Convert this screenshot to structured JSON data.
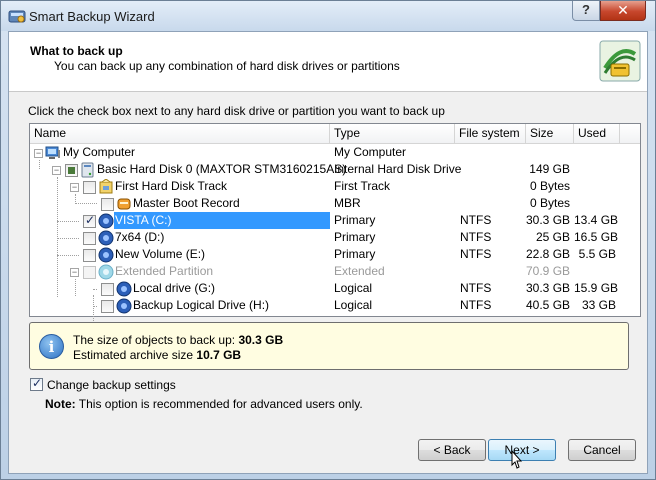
{
  "window": {
    "title": "Smart Backup Wizard",
    "help_label": "?",
    "close_label": "✕"
  },
  "header": {
    "title": "What to back up",
    "subtitle": "You can back up any combination of hard disk drives or partitions"
  },
  "instruction": "Click the check box next to any hard disk drive or partition you want to back up",
  "columns": {
    "name": "Name",
    "type": "Type",
    "filesystem": "File system",
    "size": "Size",
    "used": "Used"
  },
  "rows": [
    {
      "name": "My Computer",
      "type": "My Computer",
      "fs": "",
      "size": "",
      "used": "",
      "icon": "computer-icon",
      "checkbox": "none"
    },
    {
      "name": "Basic Hard Disk 0 (MAXTOR STM3160215AS)",
      "type": "Internal Hard Disk Drive",
      "fs": "",
      "size": "149 GB",
      "used": "",
      "icon": "hard-disk-icon",
      "checkbox": "partial"
    },
    {
      "name": "First Hard Disk Track",
      "type": "First Track",
      "fs": "",
      "size": "0 Bytes",
      "used": "",
      "icon": "disk-track-icon",
      "checkbox": "unchecked"
    },
    {
      "name": "Master Boot Record",
      "type": "MBR",
      "fs": "",
      "size": "0 Bytes",
      "used": "",
      "icon": "mbr-icon",
      "checkbox": "unchecked"
    },
    {
      "name": "VISTA (C:)",
      "type": "Primary",
      "fs": "NTFS",
      "size": "30.3 GB",
      "used": "13.4 GB",
      "icon": "partition-icon",
      "checkbox": "checked",
      "selected": true
    },
    {
      "name": "7x64 (D:)",
      "type": "Primary",
      "fs": "NTFS",
      "size": "25 GB",
      "used": "16.5 GB",
      "icon": "partition-icon",
      "checkbox": "unchecked"
    },
    {
      "name": "New Volume (E:)",
      "type": "Primary",
      "fs": "NTFS",
      "size": "22.8 GB",
      "used": "5.5 GB",
      "icon": "partition-icon",
      "checkbox": "unchecked"
    },
    {
      "name": "Extended Partition",
      "type": "Extended",
      "fs": "",
      "size": "70.9 GB",
      "used": "",
      "icon": "extended-partition-icon",
      "checkbox": "disabled",
      "dim": true
    },
    {
      "name": "Local drive (G:)",
      "type": "Logical",
      "fs": "NTFS",
      "size": "30.3 GB",
      "used": "15.9 GB",
      "icon": "partition-icon",
      "checkbox": "unchecked"
    },
    {
      "name": "Backup Logical Drive (H:)",
      "type": "Logical",
      "fs": "NTFS",
      "size": "40.5 GB",
      "used": "33 GB",
      "icon": "partition-icon",
      "checkbox": "unchecked"
    }
  ],
  "info": {
    "size_prefix": "The size of objects to back up:",
    "size_value": "30.3 GB",
    "archive_prefix": "Estimated archive size",
    "archive_value": "10.7 GB"
  },
  "options": {
    "change_settings_label": "Change backup settings",
    "change_settings_checked": true,
    "note_label": "Note:",
    "note_text": "This option is recommended for advanced users only."
  },
  "buttons": {
    "back": "< Back",
    "next": "Next >",
    "cancel": "Cancel"
  },
  "colors": {
    "selection": "#3399ff",
    "info_background": "#fffde1",
    "close_button": "#c7472d"
  }
}
